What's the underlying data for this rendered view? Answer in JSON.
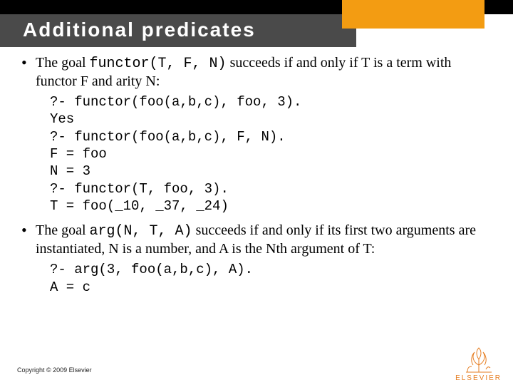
{
  "colors": {
    "accent": "#f39c12",
    "titlebar": "#4a4a4a"
  },
  "header": {
    "title": "Additional predicates"
  },
  "bullets": [
    {
      "prefix": "The goal ",
      "code": "functor(T, F, N)",
      "suffix": " succeeds if and only if T is a term with functor F and arity N:",
      "code_block": "?- functor(foo(a,b,c), foo, 3).\nYes\n?- functor(foo(a,b,c), F, N).\nF = foo\nN = 3\n?- functor(T, foo, 3).\nT = foo(_10, _37, _24)"
    },
    {
      "prefix": "The goal ",
      "code": "arg(N, T, A)",
      "suffix": " succeeds if and only if its first two arguments are instantiated, N is a number, and A is the Nth argument of T:",
      "code_block": "?- arg(3, foo(a,b,c), A).\nA = c"
    }
  ],
  "footer": {
    "copyright": "Copyright © 2009 Elsevier",
    "publisher": "ELSEVIER"
  }
}
